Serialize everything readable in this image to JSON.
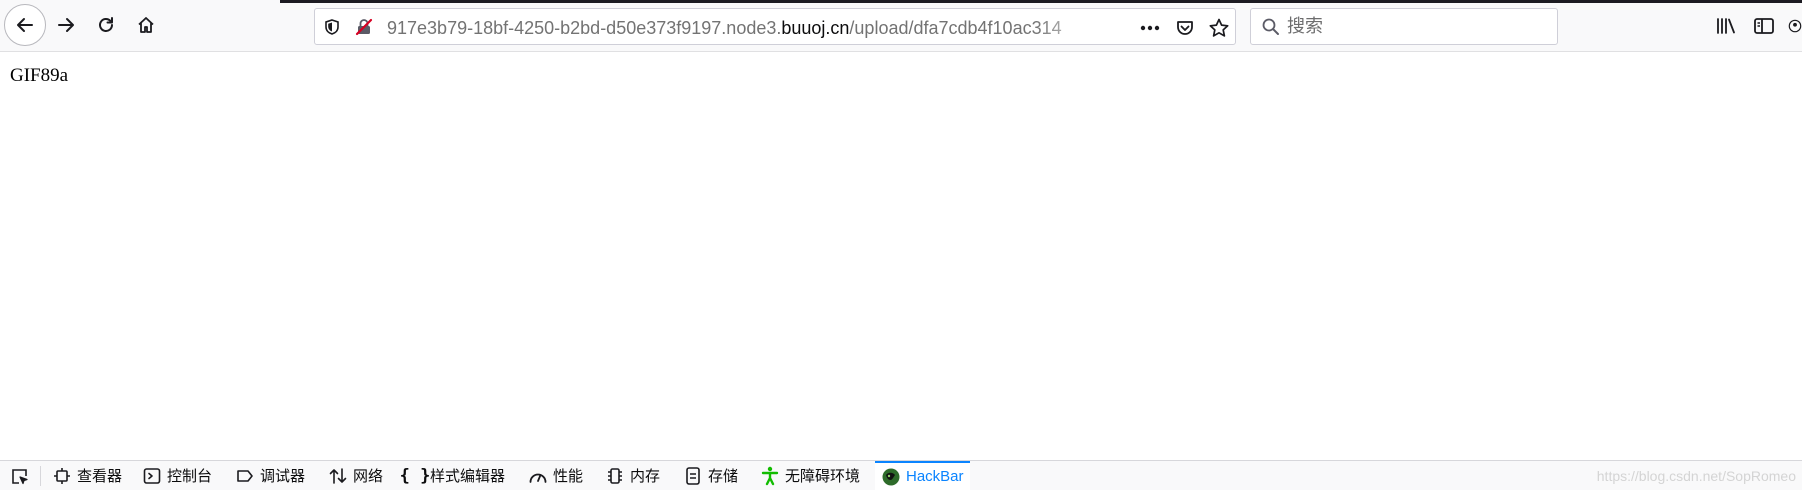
{
  "browser": {
    "url": {
      "prefix": "917e3b79-18bf-4250-b2bd-d50e373f9197.node3.",
      "domain": "buuoj.cn",
      "path": "/upload/dfa7cdb4f10ac314"
    },
    "search": {
      "placeholder": "搜索",
      "value": ""
    },
    "icons": {
      "back": "back-arrow-icon",
      "forward": "forward-arrow-icon",
      "reload": "reload-icon",
      "home": "home-icon",
      "tracking": "shield-icon",
      "insecure": "insecure-lock-icon",
      "more": "more-dots-icon",
      "pocket": "pocket-icon",
      "bookmark": "star-icon",
      "library": "library-icon",
      "sidebar": "sidebar-icon"
    }
  },
  "page": {
    "body_text": "GIF89a"
  },
  "devtools": {
    "tabs": [
      {
        "label": "查看器",
        "icon": "inspector-icon"
      },
      {
        "label": "控制台",
        "icon": "console-icon"
      },
      {
        "label": "调试器",
        "icon": "debugger-icon"
      },
      {
        "label": "网络",
        "icon": "network-icon"
      },
      {
        "label": "样式编辑器",
        "icon": "style-editor-icon"
      },
      {
        "label": "性能",
        "icon": "performance-icon"
      },
      {
        "label": "内存",
        "icon": "memory-icon"
      },
      {
        "label": "存储",
        "icon": "storage-icon"
      },
      {
        "label": "无障碍环境",
        "icon": "accessibility-icon"
      },
      {
        "label": "HackBar",
        "icon": "hackbar-icon",
        "active": true
      }
    ],
    "watermark": "https://blog.csdn.net/SopRomeo"
  },
  "colors": {
    "accent": "#0a84ff",
    "insecure": "#d70022",
    "accessibility": "#12bc00"
  }
}
